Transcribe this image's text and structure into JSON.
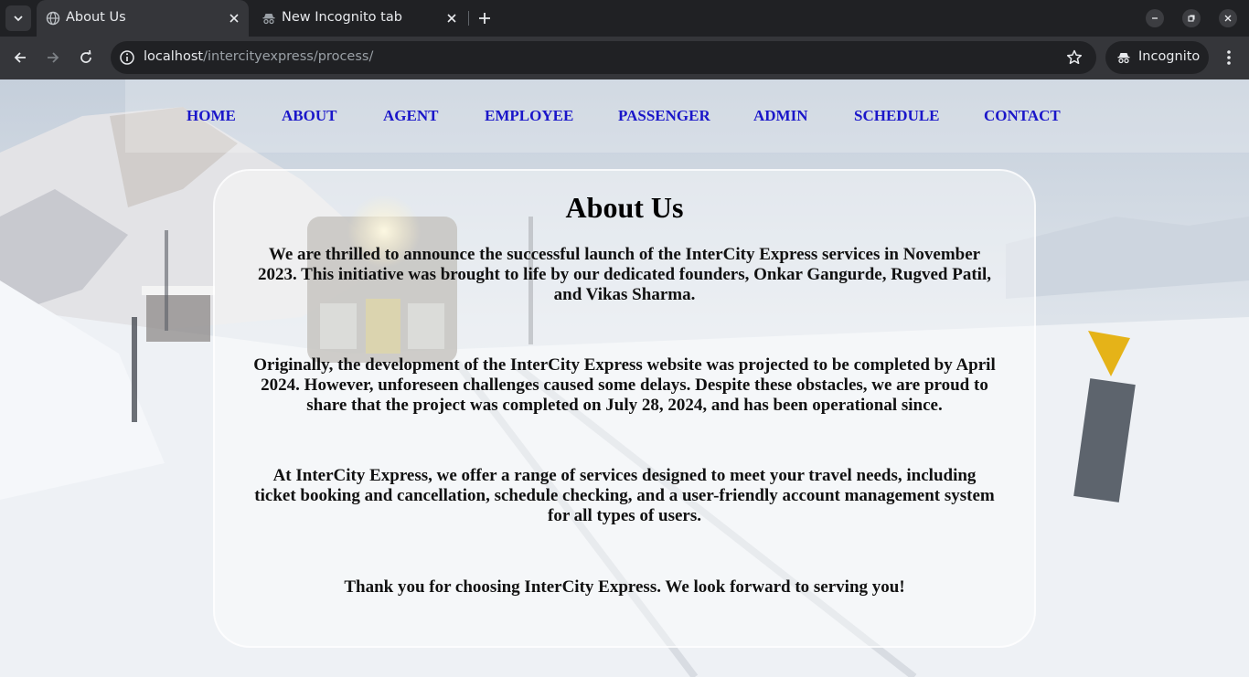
{
  "browser": {
    "tabs": [
      {
        "title": "About Us",
        "active": true,
        "icon": "globe-icon"
      },
      {
        "title": "New Incognito tab",
        "active": false,
        "icon": "incognito-icon"
      }
    ],
    "url_host": "localhost",
    "url_path": "/intercityexpress/process/",
    "profile_label": "Incognito"
  },
  "nav": {
    "items": [
      {
        "label": "HOME"
      },
      {
        "label": "ABOUT"
      },
      {
        "label": "AGENT"
      },
      {
        "label": "EMPLOYEE"
      },
      {
        "label": "PASSENGER"
      },
      {
        "label": "ADMIN"
      },
      {
        "label": "SCHEDULE"
      },
      {
        "label": "CONTACT"
      }
    ]
  },
  "about": {
    "title": "About Us",
    "paragraphs": [
      "We are thrilled to announce the successful launch of the InterCity Express services in November 2023. This initiative was brought to life by our dedicated founders, Onkar Gangurde, Rugved Patil, and Vikas Sharma.",
      "Originally, the development of the InterCity Express website was projected to be completed by April 2024. However, unforeseen challenges caused some delays. Despite these obstacles, we are proud to share that the project was completed on July 28, 2024, and has been operational since.",
      "At InterCity Express, we offer a range of services designed to meet your travel needs, including ticket booking and cancellation, schedule checking, and a user-friendly account management system for all types of users.",
      "Thank you for choosing InterCity Express. We look forward to serving you!"
    ]
  },
  "colors": {
    "nav_link": "#1a16c9",
    "chrome_dark": "#202124",
    "chrome_tab": "#35363a"
  }
}
